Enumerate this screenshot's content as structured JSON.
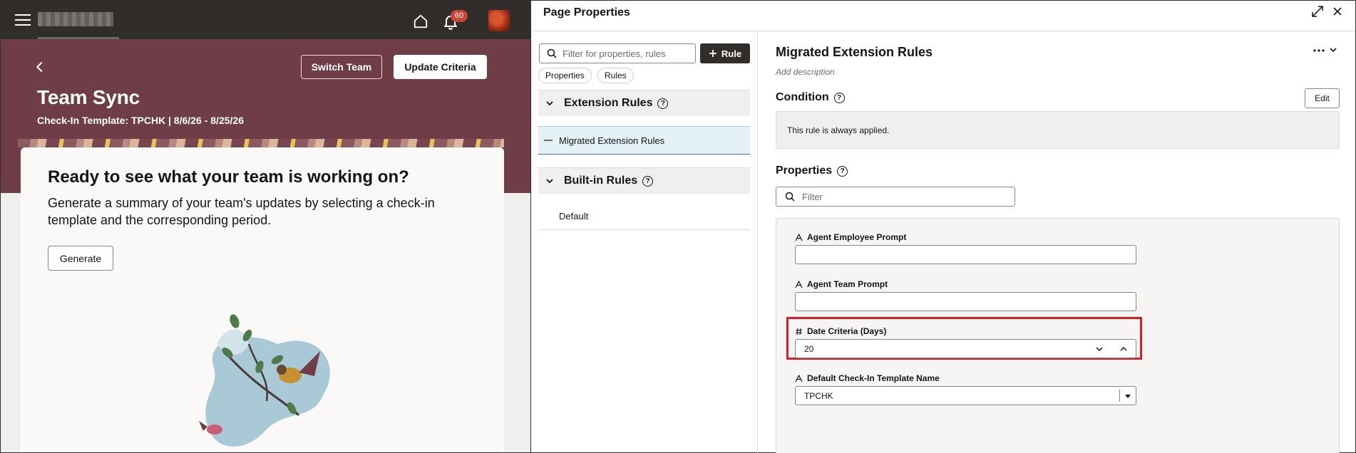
{
  "left": {
    "notifications_count": "60",
    "hero": {
      "switch_team_label": "Switch Team",
      "update_criteria_label": "Update Criteria",
      "title": "Team Sync",
      "subtitle": "Check-In Template: TPCHK | 8/6/26 - 8/25/26"
    },
    "card": {
      "heading": "Ready to see what your team is working on?",
      "description": "Generate a summary of your team's updates by selecting a check-in template and the corresponding period.",
      "generate_label": "Generate"
    }
  },
  "drawer": {
    "title": "Page Properties",
    "search_placeholder": "Filter for properties, rules",
    "add_rule_label": "Rule",
    "chips": [
      "Properties",
      "Rules"
    ],
    "groups": {
      "extension": {
        "label": "Extension Rules",
        "items": [
          "Migrated Extension Rules"
        ]
      },
      "builtin": {
        "label": "Built-in Rules",
        "items": [
          "Default"
        ]
      }
    },
    "detail": {
      "title": "Migrated Extension Rules",
      "description_placeholder": "Add description",
      "condition_label": "Condition",
      "edit_label": "Edit",
      "condition_text": "This rule is always applied.",
      "properties_label": "Properties",
      "filter_placeholder": "Filter",
      "fields": {
        "agent_employee_prompt": {
          "label": "Agent Employee Prompt",
          "value": ""
        },
        "agent_team_prompt": {
          "label": "Agent Team Prompt",
          "value": ""
        },
        "date_criteria": {
          "label": "Date Criteria (Days)",
          "value": "20"
        },
        "default_template": {
          "label": "Default Check-In Template Name",
          "value": "TPCHK"
        }
      }
    }
  },
  "colors": {
    "topbar": "#312d2a",
    "hero": "#6f3d48",
    "badge": "#c74634",
    "highlight": "#d41f26",
    "selected_row": "#e4f1f7"
  }
}
